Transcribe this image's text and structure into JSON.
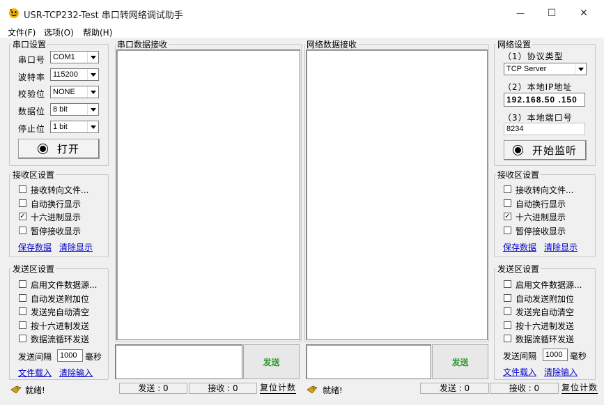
{
  "window": {
    "title": "USR-TCP232-Test 串口转网络调试助手",
    "minimize_glyph": "—",
    "maximize_glyph": "☐",
    "close_glyph": "✕"
  },
  "menu": [
    "文件(F)",
    "选项(O)",
    "帮助(H)"
  ],
  "serial_settings": {
    "title": "串口设置",
    "port_label": "串口号",
    "port_value": "COM1",
    "baud_label": "波特率",
    "baud_value": "115200",
    "parity_label": "校验位",
    "parity_value": "NONE",
    "data_bits_label": "数据位",
    "data_bits_value": "8 bit",
    "stop_bits_label": "停止位",
    "stop_bits_value": "1 bit",
    "open_button": "打开"
  },
  "left_receive_settings": {
    "title": "接收区设置",
    "options": [
      {
        "label": "接收转向文件...",
        "checked": false
      },
      {
        "label": "自动换行显示",
        "checked": false
      },
      {
        "label": "十六进制显示",
        "checked": true
      },
      {
        "label": "暂停接收显示",
        "checked": false
      }
    ],
    "save_link": "保存数据",
    "clear_link": "清除显示"
  },
  "left_send_settings": {
    "title": "发送区设置",
    "options": [
      {
        "label": "启用文件数据源...",
        "checked": false
      },
      {
        "label": "自动发送附加位",
        "checked": false
      },
      {
        "label": "发送完自动清空",
        "checked": false
      },
      {
        "label": "按十六进制发送",
        "checked": false
      },
      {
        "label": "数据流循环发送",
        "checked": false
      }
    ],
    "interval_label": "发送间隔",
    "interval_value": "1000",
    "interval_unit": "毫秒",
    "load_file_link": "文件载入",
    "clear_input_link": "清除输入"
  },
  "serial_receive": {
    "title": "串口数据接收",
    "send_button": "发送"
  },
  "network_receive": {
    "title": "网络数据接收",
    "send_button": "发送"
  },
  "network_settings": {
    "title": "网络设置",
    "protocol_label": "（1）协议类型",
    "protocol_value": "TCP Server",
    "ip_label": "（2）本地IP地址",
    "ip_value": "192.168.50 .150",
    "port_label": "（3）本地端口号",
    "port_value": "8234",
    "listen_button": "开始监听"
  },
  "right_receive_settings": {
    "title": "接收区设置",
    "options": [
      {
        "label": "接收转向文件...",
        "checked": false
      },
      {
        "label": "自动换行显示",
        "checked": false
      },
      {
        "label": "十六进制显示",
        "checked": true
      },
      {
        "label": "暂停接收显示",
        "checked": false
      }
    ],
    "save_link": "保存数据",
    "clear_link": "清除显示"
  },
  "right_send_settings": {
    "title": "发送区设置",
    "options": [
      {
        "label": "启用文件数据源...",
        "checked": false
      },
      {
        "label": "自动发送附加位",
        "checked": false
      },
      {
        "label": "发送完自动清空",
        "checked": false
      },
      {
        "label": "按十六进制发送",
        "checked": false
      },
      {
        "label": "数据流循环发送",
        "checked": false
      }
    ],
    "interval_label": "发送间隔",
    "interval_value": "1000",
    "interval_unit": "毫秒",
    "load_file_link": "文件载入",
    "clear_input_link": "清除输入"
  },
  "status_left": {
    "ready": "就绪!",
    "sent": "发送 : 0",
    "received": "接收 : 0",
    "reset": "复位计数"
  },
  "status_right": {
    "ready": "就绪!",
    "sent": "发送 : 0",
    "received": "接收 : 0",
    "reset": "复位计数"
  },
  "check_glyph": "✓"
}
